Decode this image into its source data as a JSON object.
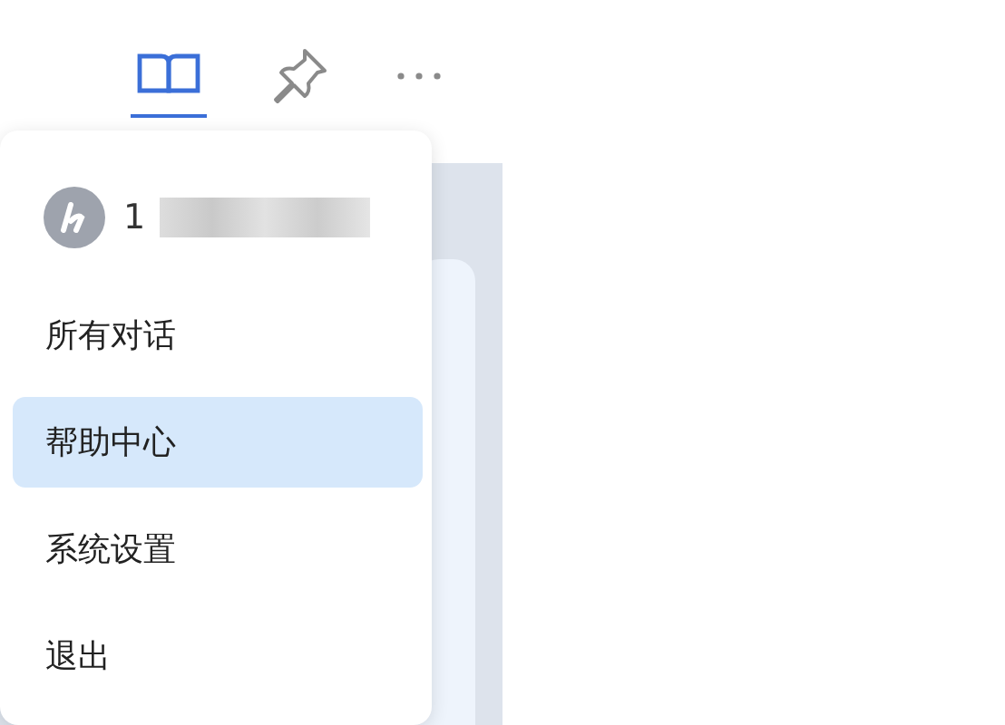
{
  "toolbar": [
    {
      "kind": "book",
      "selected": true
    },
    {
      "kind": "pin",
      "selected": false
    },
    {
      "kind": "more",
      "selected": false
    }
  ],
  "menu": {
    "user": {
      "name": "1",
      "redacted": true
    },
    "items": [
      {
        "label": "所有对话",
        "selected": false
      },
      {
        "label": "帮助中心",
        "selected": true
      },
      {
        "label": "系统设置",
        "selected": false
      },
      {
        "label": "退出",
        "selected": false
      }
    ]
  }
}
